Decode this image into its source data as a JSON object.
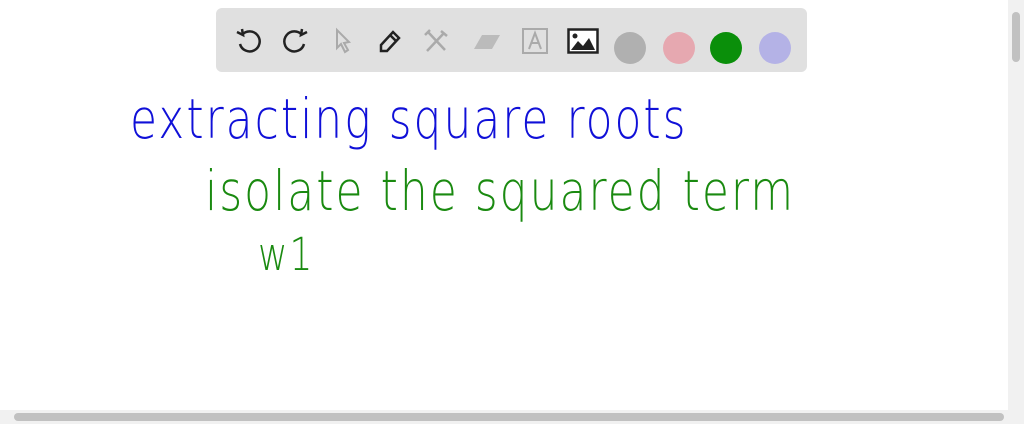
{
  "toolbar": {
    "tools": [
      "undo-icon",
      "redo-icon",
      "pointer-icon",
      "pen-icon",
      "tools-icon",
      "eraser-icon",
      "text-icon",
      "image-icon"
    ],
    "colors": [
      "#b0b0b0",
      "#e6a8b0",
      "#0a8f0a",
      "#b4b2e6"
    ]
  },
  "canvas": {
    "line1": "extracting square roots",
    "line2": "isolate the squared term",
    "line3": "w1",
    "blue": "#1010d8",
    "green": "#1a8a10"
  }
}
